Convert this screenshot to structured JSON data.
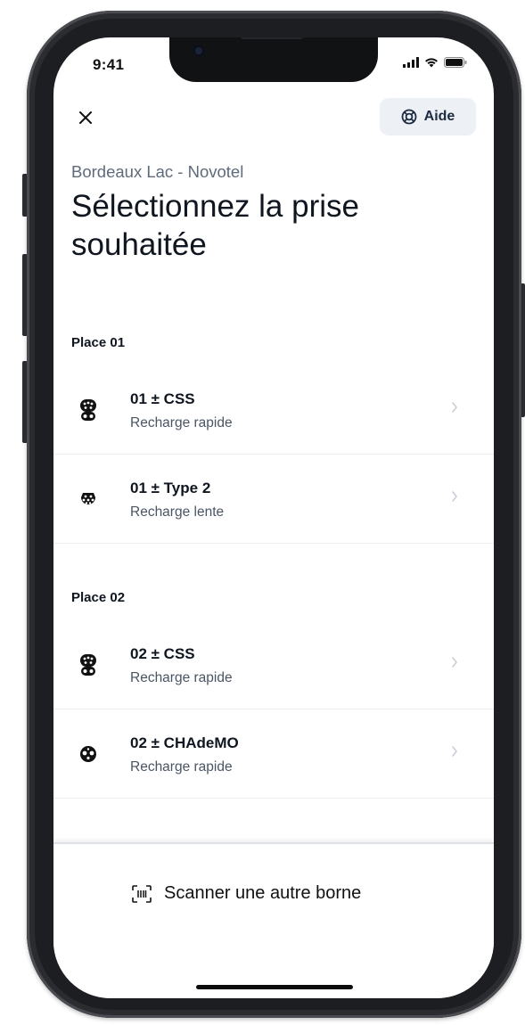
{
  "status_bar": {
    "time": "9:41"
  },
  "header": {
    "close_icon": "close-icon",
    "help_label": "Aide",
    "help_icon": "lifebuoy-icon"
  },
  "location": "Bordeaux Lac - Novotel",
  "title": "Sélectionnez la prise souhaitée",
  "sections": [
    {
      "label": "Place 01",
      "connectors": [
        {
          "name": "01 ± CSS",
          "subtitle": "Recharge rapide",
          "icon": "ccs-plug-icon"
        },
        {
          "name": "01 ± Type 2",
          "subtitle": "Recharge lente",
          "icon": "type2-plug-icon"
        }
      ]
    },
    {
      "label": "Place 02",
      "connectors": [
        {
          "name": "02 ± CSS",
          "subtitle": "Recharge rapide",
          "icon": "ccs-plug-icon"
        },
        {
          "name": "02 ± CHAdeMO",
          "subtitle": "Recharge rapide",
          "icon": "chademo-plug-icon"
        }
      ]
    }
  ],
  "footer": {
    "scan_label": "Scanner une autre borne",
    "scan_icon": "qr-scan-icon"
  },
  "colors": {
    "help_button_bg": "#edf1f6",
    "text_primary": "#0f1620",
    "text_secondary": "#5d6b7b"
  }
}
